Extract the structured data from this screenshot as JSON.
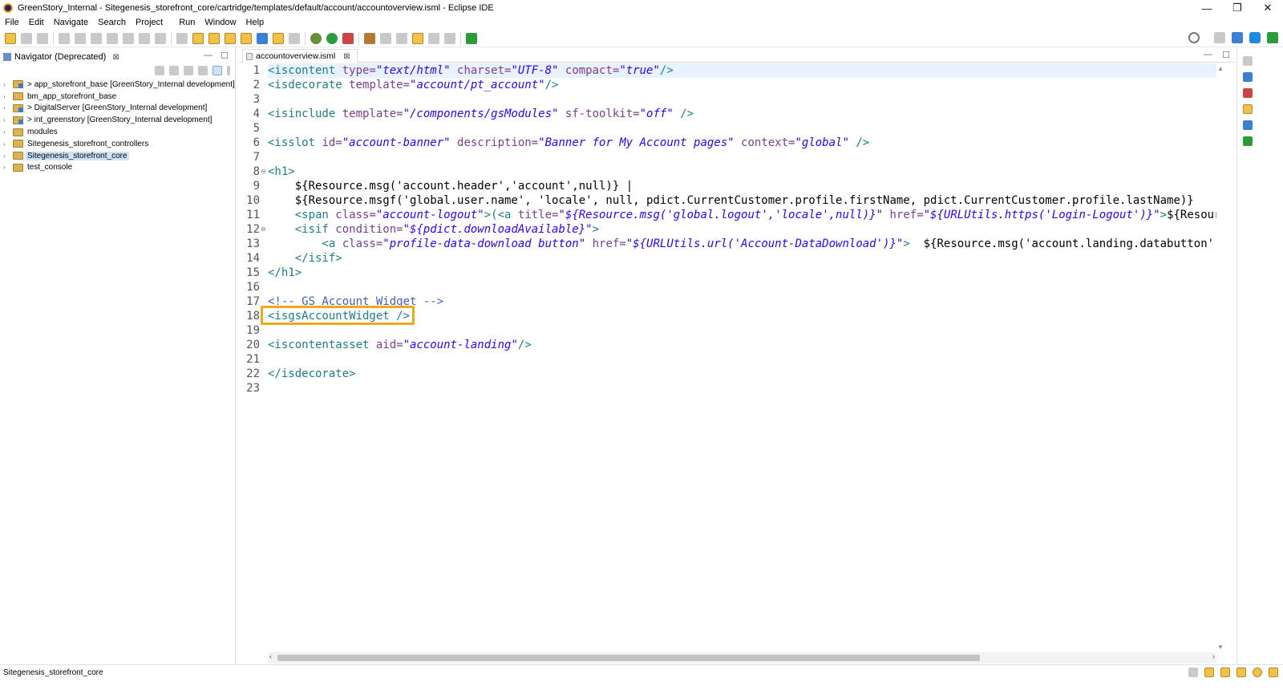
{
  "window": {
    "title": "GreenStory_Internal - Sitegenesis_storefront_core/cartridge/templates/default/account/accountoverview.isml - Eclipse IDE",
    "controls": [
      "—",
      "❐",
      "✕"
    ]
  },
  "menu": [
    "File",
    "Edit",
    "Navigate",
    "Search",
    "Project",
    "Run",
    "Window",
    "Help"
  ],
  "navigator": {
    "tab_label": "Navigator (Deprecated)",
    "tree": [
      {
        "label": "> app_storefront_base [GreenStory_Internal development]",
        "type": "project"
      },
      {
        "label": "bm_app_storefront_base",
        "type": "folder"
      },
      {
        "label": "> DigitalServer [GreenStory_Internal development]",
        "type": "project"
      },
      {
        "label": "> int_greenstory [GreenStory_Internal development]",
        "type": "project"
      },
      {
        "label": "modules",
        "type": "folder"
      },
      {
        "label": "Sitegenesis_storefront_controllers",
        "type": "folder"
      },
      {
        "label": "Sitegenesis_storefront_core",
        "type": "folder",
        "selected": true
      },
      {
        "label": "test_console",
        "type": "folder"
      }
    ]
  },
  "editor": {
    "tab_label": "accountoverview.isml",
    "lines": [
      {
        "n": "1",
        "fold": "",
        "parts": [
          [
            "tag",
            "<iscontent "
          ],
          [
            "attr",
            "type="
          ],
          [
            "val",
            "\"text/html\""
          ],
          [
            "attr",
            " charset="
          ],
          [
            "val",
            "\"UTF-8\""
          ],
          [
            "attr",
            " compact="
          ],
          [
            "val",
            "\"true\""
          ],
          [
            "tag",
            "/>"
          ]
        ]
      },
      {
        "n": "2",
        "fold": "",
        "parts": [
          [
            "tag",
            "<isdecorate "
          ],
          [
            "attr",
            "template="
          ],
          [
            "val",
            "\"account/pt_account\""
          ],
          [
            "tag",
            "/>"
          ]
        ]
      },
      {
        "n": "3",
        "fold": "",
        "parts": []
      },
      {
        "n": "4",
        "fold": "",
        "parts": [
          [
            "tag",
            "<isinclude "
          ],
          [
            "attr",
            "template="
          ],
          [
            "val",
            "\"/components/gsModules\""
          ],
          [
            "attr",
            " sf-toolkit="
          ],
          [
            "val",
            "\"off\""
          ],
          [
            "tag",
            " />"
          ]
        ]
      },
      {
        "n": "5",
        "fold": "",
        "parts": []
      },
      {
        "n": "6",
        "fold": "",
        "parts": [
          [
            "tag",
            "<isslot "
          ],
          [
            "attr",
            "id="
          ],
          [
            "val",
            "\"account-banner\""
          ],
          [
            "attr",
            " description="
          ],
          [
            "val",
            "\"Banner for My Account pages\""
          ],
          [
            "attr",
            " context="
          ],
          [
            "val",
            "\"global\""
          ],
          [
            "tag",
            " />"
          ]
        ]
      },
      {
        "n": "7",
        "fold": "",
        "parts": []
      },
      {
        "n": "8",
        "fold": "⊖",
        "parts": [
          [
            "tag",
            "<h1>"
          ]
        ]
      },
      {
        "n": "9",
        "fold": "",
        "parts": [
          [
            "text",
            "    ${Resource.msg('account.header','account',null)} |"
          ]
        ]
      },
      {
        "n": "10",
        "fold": "",
        "parts": [
          [
            "text",
            "    ${Resource.msgf('global.user.name', 'locale', null, pdict.CurrentCustomer.profile.firstName, pdict.CurrentCustomer.profile.lastName)}"
          ]
        ]
      },
      {
        "n": "11",
        "fold": "",
        "parts": [
          [
            "tag",
            "    <span "
          ],
          [
            "attr",
            "class="
          ],
          [
            "val",
            "\"account-logout\""
          ],
          [
            "tag",
            ">(<a "
          ],
          [
            "attr",
            "title="
          ],
          [
            "val",
            "\"${Resource.msg('global.logout','locale',null)}\""
          ],
          [
            "attr",
            " href="
          ],
          [
            "val",
            "\"${URLUtils.https('Login-Logout')}\""
          ],
          [
            "tag",
            ">"
          ],
          [
            "text",
            "${Resource.m"
          ]
        ]
      },
      {
        "n": "12",
        "fold": "⊖",
        "parts": [
          [
            "tag",
            "    <isif "
          ],
          [
            "attr",
            "condition="
          ],
          [
            "val",
            "\"${pdict.downloadAvailable}\""
          ],
          [
            "tag",
            ">"
          ]
        ]
      },
      {
        "n": "13",
        "fold": "",
        "parts": [
          [
            "tag",
            "        <a "
          ],
          [
            "attr",
            "class="
          ],
          [
            "val",
            "\"profile-data-download button\""
          ],
          [
            "attr",
            " href="
          ],
          [
            "val",
            "\"${URLUtils.url('Account-DataDownload')}\""
          ],
          [
            "tag",
            ">"
          ],
          [
            "text",
            "  ${Resource.msg('account.landing.databutton','acc"
          ]
        ]
      },
      {
        "n": "14",
        "fold": "",
        "parts": [
          [
            "tag",
            "    </isif>"
          ]
        ]
      },
      {
        "n": "15",
        "fold": "",
        "parts": [
          [
            "tag",
            "</h1>"
          ]
        ]
      },
      {
        "n": "16",
        "fold": "",
        "parts": []
      },
      {
        "n": "17",
        "fold": "",
        "parts": [
          [
            "comment",
            "<!-- GS Account Widget -->"
          ]
        ]
      },
      {
        "n": "18",
        "fold": "",
        "parts": [
          [
            "tag",
            "<isgsAccountWidget />"
          ]
        ]
      },
      {
        "n": "19",
        "fold": "",
        "parts": []
      },
      {
        "n": "20",
        "fold": "",
        "parts": [
          [
            "tag",
            "<iscontentasset "
          ],
          [
            "attr",
            "aid="
          ],
          [
            "val",
            "\"account-landing\""
          ],
          [
            "tag",
            "/>"
          ]
        ]
      },
      {
        "n": "21",
        "fold": "",
        "parts": []
      },
      {
        "n": "22",
        "fold": "",
        "parts": [
          [
            "tag",
            "</isdecorate>"
          ]
        ]
      },
      {
        "n": "23",
        "fold": "",
        "parts": []
      }
    ]
  },
  "status": {
    "selection": "Sitegenesis_storefront_core"
  },
  "colors": {
    "tag": "#1a7e8a",
    "attribute": "#7a3d8f",
    "value": "#2a00ff",
    "highlight_border": "#f0a81c",
    "selection": "#cce4f7"
  }
}
